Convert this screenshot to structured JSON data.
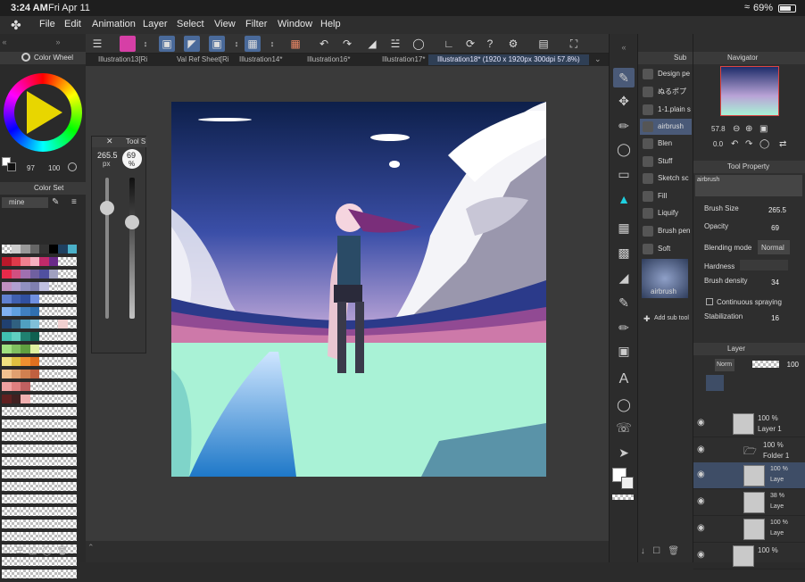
{
  "status": {
    "time": "3:24 AM",
    "date": "Fri Apr 11",
    "battery": "69%"
  },
  "menu": [
    "File",
    "Edit",
    "Animation",
    "Layer",
    "Select",
    "View",
    "Filter",
    "Window",
    "Help"
  ],
  "doc_tabs": [
    "Illustration13[Ri",
    "Val Ref Sheet[Ri",
    "Illustration14*",
    "Illustration16*",
    "Illustration17*",
    "Illustration18* (1920 x 1920px 300dpi 57.8%)"
  ],
  "color_wheel": {
    "title": "Color Wheel",
    "value_a": "97",
    "value_b": "100"
  },
  "color_set": {
    "title": "Color Set",
    "set_name": "mine"
  },
  "tool_slider": {
    "title": "Tool S",
    "size": "265.5",
    "size_unit": "px",
    "opacity": "69",
    "opacity_unit": "%"
  },
  "sub_tool": {
    "title": "Sub",
    "items": [
      "Design pe",
      "ぬるポプ",
      "1-1.plain s",
      "airbrush",
      "Blen",
      "Stuff",
      "Sketch sc",
      "Fill",
      "Liquify",
      "Brush pen",
      "Soft"
    ],
    "preview_label": "airbrush",
    "add_label": "Add sub tool"
  },
  "navigator": {
    "title": "Navigator",
    "zoom": "57.8",
    "rotation": "0.0"
  },
  "tool_property": {
    "title": "Tool Property",
    "preset_label": "airbrush",
    "brush_size_label": "Brush Size",
    "brush_size": "265.5",
    "opacity_label": "Opacity",
    "opacity": "69",
    "blending_label": "Blending mode",
    "blending_value": "Normal",
    "hardness_label": "Hardness",
    "density_label": "Brush density",
    "density": "34",
    "cont_spray_label": "Continuous spraying",
    "stabilization_label": "Stabilization",
    "stabilization": "16"
  },
  "layer": {
    "title": "Layer",
    "blend": "Norm",
    "opacity": "100",
    "rows": [
      {
        "pct": "100 %",
        "name": "Layer 1"
      },
      {
        "pct": "100 %",
        "name": "Folder 1"
      },
      {
        "pct": "100 %",
        "name": "Laye"
      },
      {
        "pct": "38 %",
        "name": "Laye"
      },
      {
        "pct": "100 %",
        "name": "Laye"
      },
      {
        "pct": "100 %",
        "name": ""
      }
    ]
  },
  "colors": {
    "accent": "#4a5a78",
    "panel": "#2e2e2e",
    "canvas_bg": "#3a3a3a"
  }
}
